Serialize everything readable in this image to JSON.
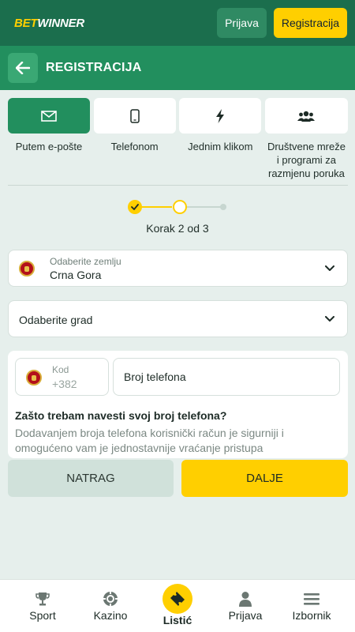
{
  "header": {
    "logo_bet": "BET",
    "logo_winner": "WINNER",
    "login_label": "Prijava",
    "register_label": "Registracija"
  },
  "title_bar": {
    "title": "REGISTRACIJA",
    "back_icon": "arrow-left-icon"
  },
  "methods": [
    {
      "label": "Putem e-pošte",
      "icon": "envelope-icon",
      "active": true
    },
    {
      "label": "Telefonom",
      "icon": "mobile-phone-icon",
      "active": false
    },
    {
      "label": "Jednim klikom",
      "icon": "lightning-icon",
      "active": false
    },
    {
      "label": "Društvene mreže i programi za razmjenu poruka",
      "icon": "users-icon",
      "active": false
    }
  ],
  "stepper": {
    "current": 2,
    "total": 3,
    "text": "Korak 2 od 3"
  },
  "country": {
    "label": "Odaberite zemlju",
    "value": "Crna Gora",
    "flag_icon": "montenegro-flag-icon"
  },
  "city": {
    "placeholder": "Odaberite grad"
  },
  "phone": {
    "code_label": "Kod",
    "code_value": "+382",
    "placeholder": "Broj telefona",
    "why_title": "Zašto trebam navesti svoj broj telefona?",
    "why_text": "Dodavanjem broja telefona korisnički račun je sigurniji i omogućeno vam je jednostavnije vraćanje pristupa"
  },
  "actions": {
    "back_label": "NATRAG",
    "next_label": "DALJE"
  },
  "bottom_nav": [
    {
      "label": "Sport",
      "icon": "trophy-icon"
    },
    {
      "label": "Kazino",
      "icon": "casino-chip-icon"
    },
    {
      "label": "Listić",
      "icon": "ticket-icon"
    },
    {
      "label": "Prijava",
      "icon": "user-icon"
    },
    {
      "label": "Izbornik",
      "icon": "menu-icon"
    }
  ],
  "colors": {
    "header_green": "#1b6e4d",
    "title_green": "#228f5e",
    "accent_yellow": "#ffcf00",
    "background": "#e6efec"
  }
}
